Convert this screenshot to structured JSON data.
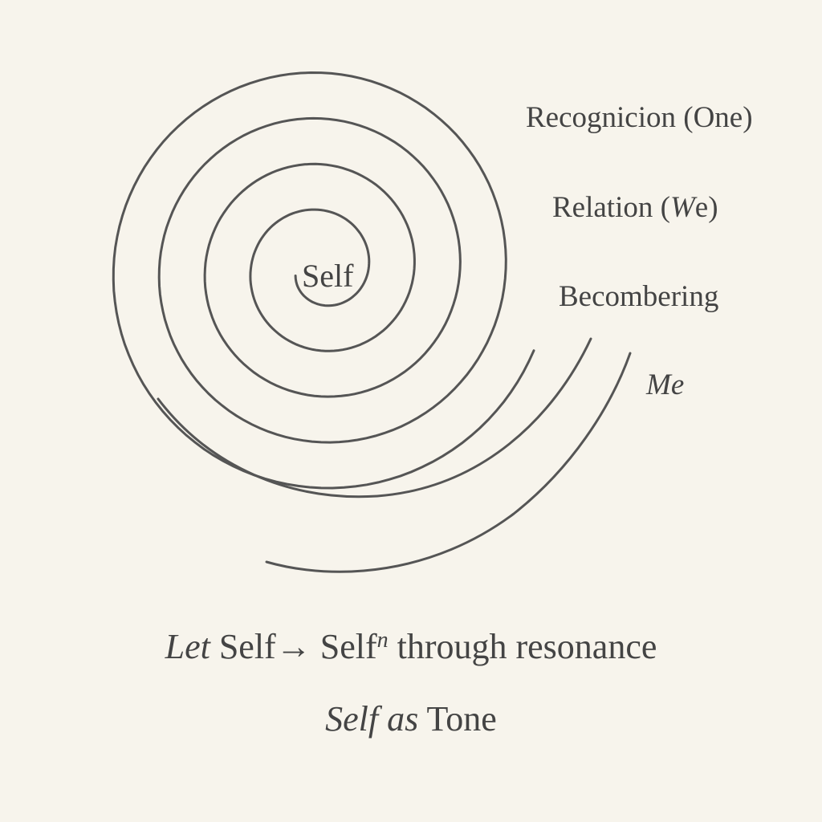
{
  "diagram": {
    "center_label": "Self",
    "ring_labels": [
      {
        "text": "Recognicion (One)"
      },
      {
        "text_before": "Relation (",
        "italic": "W",
        "text_after": "e)"
      },
      {
        "text": "Becombering"
      },
      {
        "text": "Me"
      }
    ],
    "stroke_color": "#555555",
    "background": "#f7f4ec"
  },
  "caption": {
    "line1": {
      "let": "Let",
      "self": "Self",
      "arrow": "→",
      "self2": "Self",
      "exponent": "n",
      "rest": "through resonance"
    },
    "line2": {
      "self": "Self",
      "as": "as",
      "tone": "Tone"
    }
  }
}
